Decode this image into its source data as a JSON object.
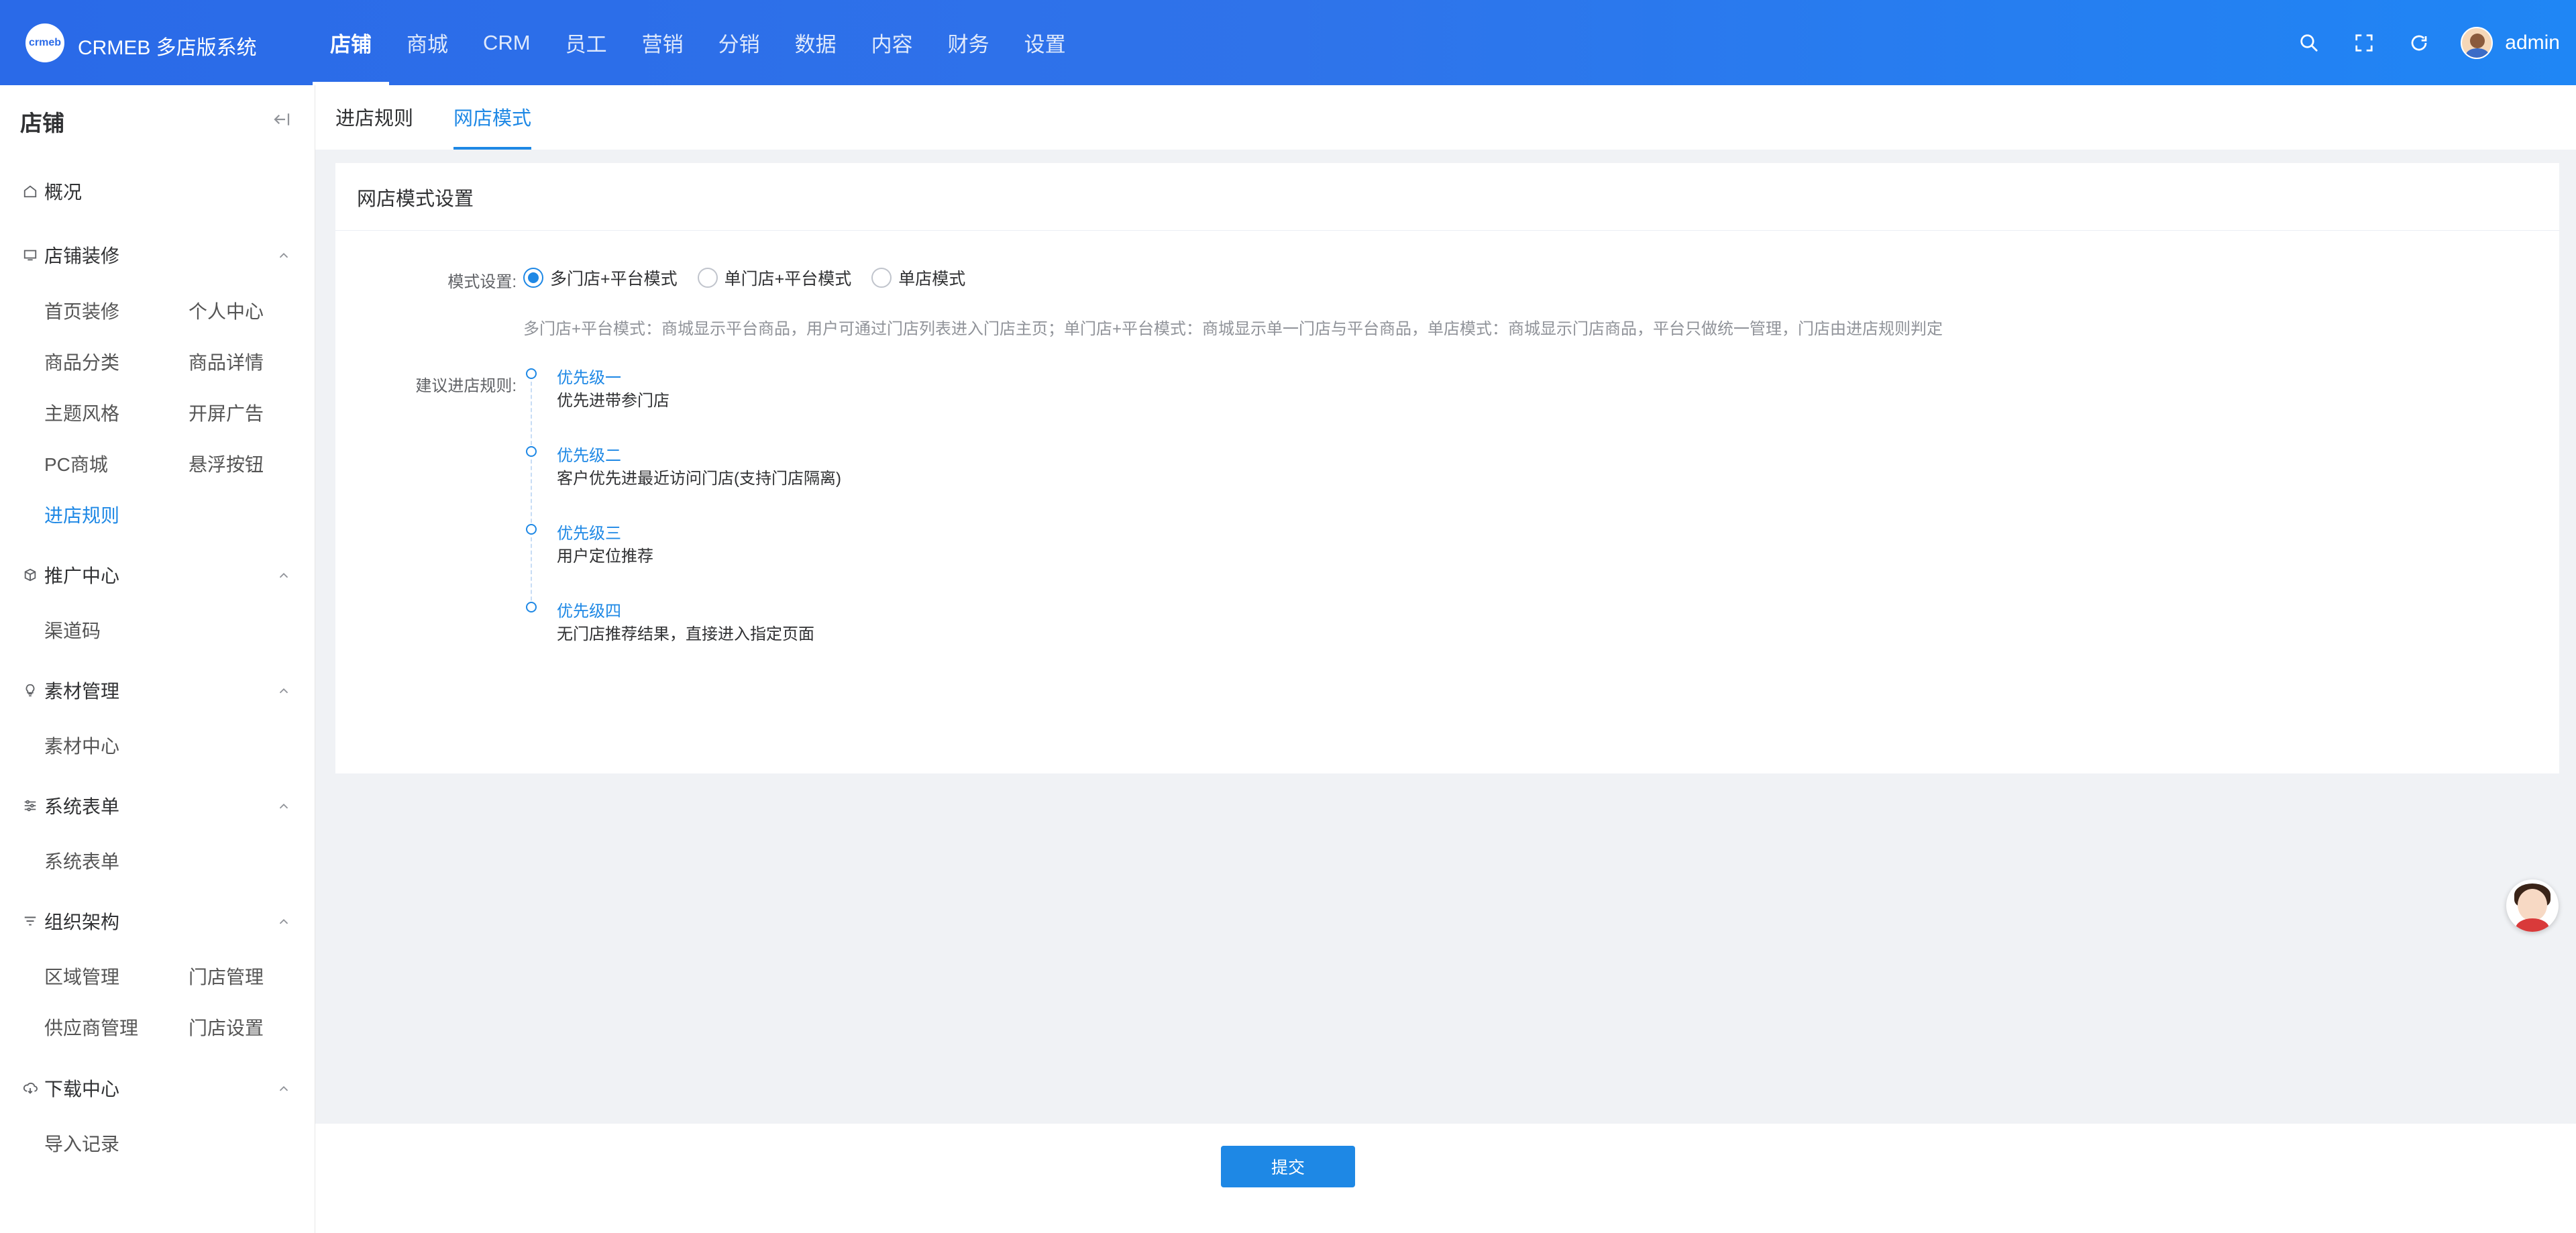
{
  "app": {
    "logo_text": "crmeb",
    "title": "CRMEB 多店版系统"
  },
  "nav": [
    {
      "label": "店铺",
      "active": true
    },
    {
      "label": "商城"
    },
    {
      "label": "CRM"
    },
    {
      "label": "员工"
    },
    {
      "label": "营销"
    },
    {
      "label": "分销"
    },
    {
      "label": "数据"
    },
    {
      "label": "内容"
    },
    {
      "label": "财务"
    },
    {
      "label": "设置"
    }
  ],
  "header": {
    "user_name": "admin",
    "icons": [
      "search-icon",
      "fullscreen-icon",
      "refresh-icon"
    ]
  },
  "sidebar": {
    "title": "店铺",
    "overview": "概况",
    "groups": [
      {
        "label": "店铺装修",
        "items": [
          "首页装修",
          "个人中心",
          "商品分类",
          "商品详情",
          "主题风格",
          "开屏广告",
          "PC商城",
          "悬浮按钮",
          "进店规则"
        ]
      },
      {
        "label": "推广中心",
        "items": [
          "渠道码"
        ]
      },
      {
        "label": "素材管理",
        "items": [
          "素材中心"
        ]
      },
      {
        "label": "系统表单",
        "items": [
          "系统表单"
        ]
      },
      {
        "label": "组织架构",
        "items": [
          "区域管理",
          "门店管理",
          "供应商管理",
          "门店设置"
        ]
      },
      {
        "label": "下载中心",
        "items": [
          "导入记录"
        ]
      }
    ],
    "active_item": "进店规则"
  },
  "tabs": [
    {
      "label": "进店规则"
    },
    {
      "label": "网店模式",
      "active": true
    }
  ],
  "card": {
    "title": "网店模式设置",
    "mode_label": "模式设置:",
    "options": [
      "多门店+平台模式",
      "单门店+平台模式",
      "单店模式"
    ],
    "selected": "多门店+平台模式",
    "hint": "多门店+平台模式：商城显示平台商品，用户可通过门店列表进入门店主页；单门店+平台模式：商城显示单一门店与平台商品，单店模式：商城显示门店商品，平台只做统一管理，门店由进店规则判定",
    "rules_label": "建议进店规则:",
    "rules": [
      {
        "title": "优先级一",
        "desc": "优先进带参门店"
      },
      {
        "title": "优先级二",
        "desc": "客户优先进最近访问门店(支持门店隔离)"
      },
      {
        "title": "优先级三",
        "desc": "用户定位推荐"
      },
      {
        "title": "优先级四",
        "desc": "无门店推荐结果，直接进入指定页面"
      }
    ]
  },
  "footer": {
    "submit_label": "提交"
  },
  "colors": {
    "primary": "#1e88e5",
    "header_start": "#2a6ae8",
    "header_end": "#1f86f5"
  }
}
